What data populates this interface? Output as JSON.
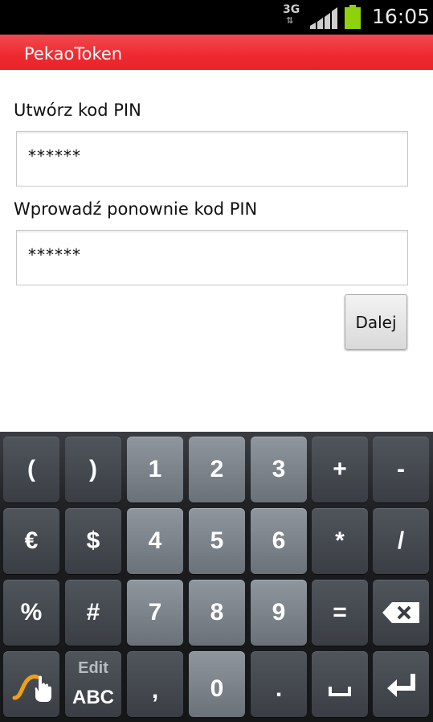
{
  "status_bar": {
    "network": "3G",
    "time": "16:05",
    "battery_color": "#8fd20c"
  },
  "app": {
    "title": "PekaoToken",
    "brand_color": "#ee2a30"
  },
  "form": {
    "pin_label": "Utwórz kod PIN",
    "pin_value": "******",
    "confirm_label": "Wprowadź ponownie kod PIN",
    "confirm_value": "******",
    "next_label": "Dalej"
  },
  "keyboard": {
    "row1": [
      "(",
      ")",
      "1",
      "2",
      "3",
      "+",
      "-"
    ],
    "row2": [
      "€",
      "$",
      "4",
      "5",
      "6",
      "*",
      "/"
    ],
    "row3": [
      "%",
      "#",
      "7",
      "8",
      "9",
      "=",
      "backspace-icon"
    ],
    "row4": {
      "swype": "swype-icon",
      "mode_top": "Edit",
      "mode_bottom": "ABC",
      "comma": ",",
      "zero": "0",
      "period": ".",
      "space": "space-icon",
      "enter": "enter-icon"
    }
  }
}
